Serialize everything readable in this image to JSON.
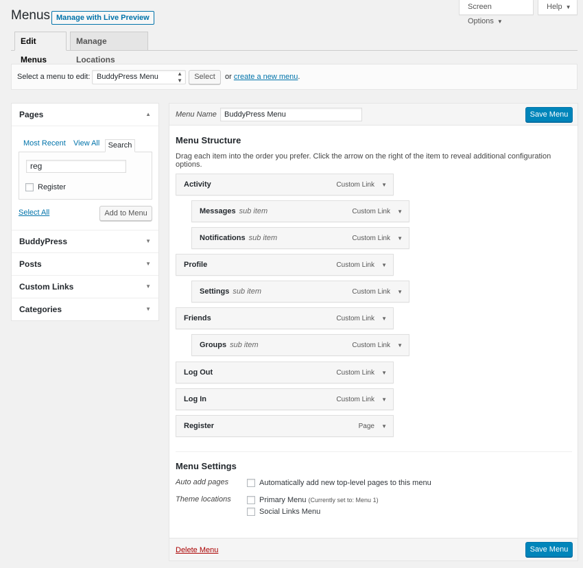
{
  "header": {
    "title": "Menus",
    "preview_button": "Manage with Live Preview",
    "screen_options": "Screen Options",
    "help": "Help"
  },
  "tabs": [
    {
      "label": "Edit Menus",
      "active": true
    },
    {
      "label": "Manage Locations",
      "active": false
    }
  ],
  "select_bar": {
    "label": "Select a menu to edit:",
    "selected_menu": "BuddyPress Menu",
    "select_button": "Select",
    "or_text": "or",
    "create_link": "create a new menu",
    "period": "."
  },
  "left_panel": {
    "pages": {
      "title": "Pages",
      "subtabs": [
        "Most Recent",
        "View All",
        "Search"
      ],
      "search_value": "reg",
      "results": [
        {
          "label": "Register",
          "checked": false
        }
      ],
      "select_all": "Select All",
      "add_button": "Add to Menu"
    },
    "sections": [
      "BuddyPress",
      "Posts",
      "Custom Links",
      "Categories"
    ]
  },
  "right_panel": {
    "menu_name_label": "Menu Name",
    "menu_name_value": "BuddyPress Menu",
    "save_button": "Save Menu",
    "structure_title": "Menu Structure",
    "structure_help": "Drag each item into the order you prefer. Click the arrow on the right of the item to reveal additional configuration options.",
    "items": [
      {
        "title": "Activity",
        "sub": "",
        "type": "Custom Link",
        "depth": 0
      },
      {
        "title": "Messages",
        "sub": "sub item",
        "type": "Custom Link",
        "depth": 1
      },
      {
        "title": "Notifications",
        "sub": "sub item",
        "type": "Custom Link",
        "depth": 1
      },
      {
        "title": "Profile",
        "sub": "",
        "type": "Custom Link",
        "depth": 0
      },
      {
        "title": "Settings",
        "sub": "sub item",
        "type": "Custom Link",
        "depth": 1
      },
      {
        "title": "Friends",
        "sub": "",
        "type": "Custom Link",
        "depth": 0
      },
      {
        "title": "Groups",
        "sub": "sub item",
        "type": "Custom Link",
        "depth": 1
      },
      {
        "title": "Log Out",
        "sub": "",
        "type": "Custom Link",
        "depth": 0
      },
      {
        "title": "Log In",
        "sub": "",
        "type": "Custom Link",
        "depth": 0
      },
      {
        "title": "Register",
        "sub": "",
        "type": "Page",
        "depth": 0
      }
    ],
    "settings": {
      "title": "Menu Settings",
      "auto_add_label": "Auto add pages",
      "auto_add_option": "Automatically add new top-level pages to this menu",
      "theme_locations_label": "Theme locations",
      "primary_menu": "Primary Menu",
      "primary_note": "(Currently set to: Menu 1)",
      "social_menu": "Social Links Menu"
    },
    "delete_link": "Delete Menu"
  },
  "colors": {
    "accent": "#0073aa",
    "primary_button": "#0085ba",
    "delete": "#a00"
  }
}
